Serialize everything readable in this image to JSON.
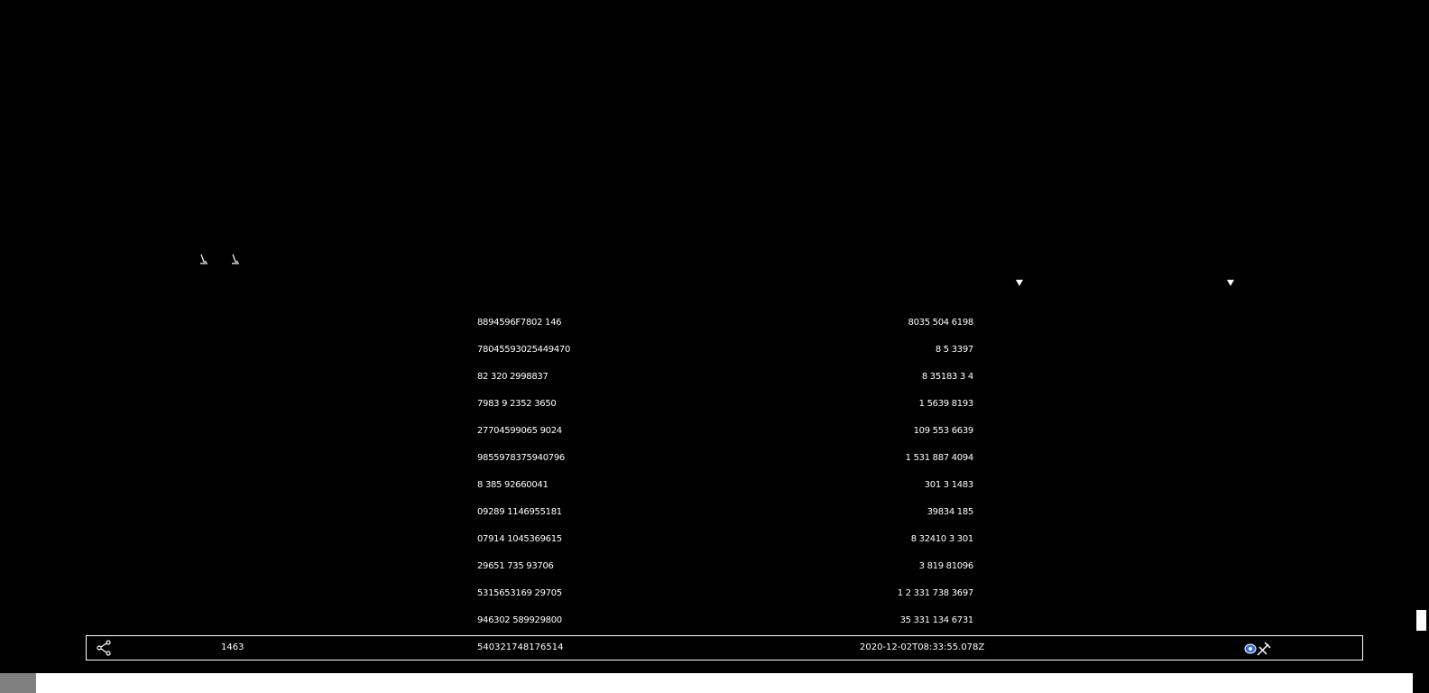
{
  "icons": {
    "sort_left": "sort-icon",
    "sort_right": "sort-icon",
    "filter_a": "filter-dropdown-icon",
    "filter_b": "filter-dropdown-icon",
    "share": "share-icon",
    "tools": "wrench-icon"
  },
  "table": {
    "rows": [
      {
        "c1": "8894596F7802 146",
        "c2": "8035 504 6198"
      },
      {
        "c1": "78045593025449470",
        "c2": "8 5 3397"
      },
      {
        "c1": "82 320 2998837",
        "c2": "8 35183 3 4"
      },
      {
        "c1": "7983 9 2352 3650",
        "c2": "1 5639 8193"
      },
      {
        "c1": "27704599065 9024",
        "c2": "109 553 6639"
      },
      {
        "c1": "9855978375940796",
        "c2": "1 531 887 4094"
      },
      {
        "c1": "8 385 92660041",
        "c2": "301 3 1483"
      },
      {
        "c1": "09289 1146955181",
        "c2": "39834 185"
      },
      {
        "c1": "07914 1045369615",
        "c2": "8 32410 3 301"
      },
      {
        "c1": "29651 735 93706",
        "c2": "3 819 81096"
      },
      {
        "c1": "5315653169 29705",
        "c2": "1 2 331 738 3697"
      },
      {
        "c1": "946302 589929800",
        "c2": "35 331 134 6731"
      }
    ]
  },
  "footer": {
    "count": "1463",
    "id": "540321748176514",
    "timestamp": "2020-12-02T08:33:55.078Z"
  },
  "colors": {
    "background": "#000000",
    "text": "#ffffff",
    "border": "#ffffff",
    "tab": "#808080",
    "accent": "#2f6fd8"
  }
}
